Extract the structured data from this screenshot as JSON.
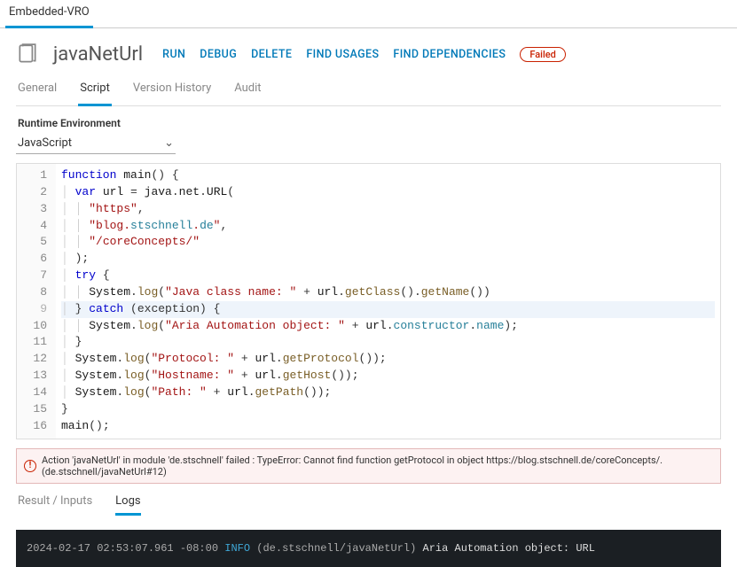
{
  "top_tab": "Embedded-VRO",
  "header": {
    "title": "javaNetUrl",
    "actions": {
      "run": "RUN",
      "debug": "DEBUG",
      "delete": "DELETE",
      "find_usages": "FIND USAGES",
      "find_dependencies": "FIND DEPENDENCIES"
    },
    "status": "Failed"
  },
  "tabs": {
    "general": "General",
    "script": "Script",
    "version_history": "Version History",
    "audit": "Audit"
  },
  "runtime": {
    "label": "Runtime Environment",
    "value": "JavaScript"
  },
  "code": {
    "lines": [
      "function main() {",
      "  var url = java.net.URL(",
      "    \"https\",",
      "    \"blog.stschnell.de\",",
      "    \"/coreConcepts/\"",
      "  );",
      "  try {",
      "    System.log(\"Java class name: \" + url.getClass().getName())",
      "  } catch (exception) {",
      "    System.log(\"Aria Automation object: \" + url.constructor.name);",
      "  }",
      "  System.log(\"Protocol: \" + url.getProtocol());",
      "  System.log(\"Hostname: \" + url.getHost());",
      "  System.log(\"Path: \" + url.getPath());",
      "}",
      "main();"
    ],
    "highlight_line": 9
  },
  "error": {
    "text": "Action 'javaNetUrl' in module 'de.stschnell' failed : TypeError: Cannot find function getProtocol in object https://blog.stschnell.de/coreConcepts/. (de.stschnell/javaNetUrl#12)"
  },
  "result_tabs": {
    "result": "Result / Inputs",
    "logs": "Logs"
  },
  "log": {
    "ts": "2024-02-17 02:53:07.961 -08:00",
    "level": "INFO",
    "source": "(de.stschnell/javaNetUrl)",
    "message": "Aria Automation object: URL"
  }
}
